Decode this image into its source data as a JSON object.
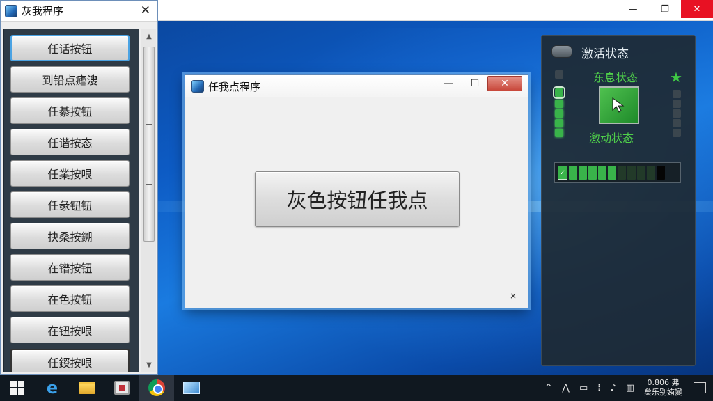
{
  "top_window": {
    "minimize": "—",
    "maximize": "❐",
    "close": "✕"
  },
  "left_window": {
    "title": "灰我程序",
    "close": "✕",
    "buttons": [
      "任话按钮",
      "到铅点瘧溲",
      "任綦按钮",
      "任谐按态",
      "任業按哏",
      "任彖钮钮",
      "抉桑按鎙",
      "在镨按钮",
      "在色按钮",
      "在钮按哏",
      "任鋄按哏"
    ],
    "scroll_up": "▲",
    "scroll_down": "▼"
  },
  "dialog": {
    "title": "任我点程序",
    "minimize": "—",
    "maximize": "☐",
    "close": "✕",
    "main_button": "灰色按钮任我点",
    "small_close": "×"
  },
  "status_panel": {
    "title": "激活状态",
    "label_top": "东息状态",
    "label_bottom": "激动状态",
    "star": "★",
    "progress_check": "✓",
    "progress_segments_on": 5,
    "progress_segments_total": 11,
    "accent_color": "#39b34a"
  },
  "taskbar": {
    "tray_icons": [
      "^",
      "⋀",
      "▭",
      "⁞",
      "♪",
      "▥"
    ],
    "time": "0.806 弗",
    "date": "矣乐别姷變"
  }
}
